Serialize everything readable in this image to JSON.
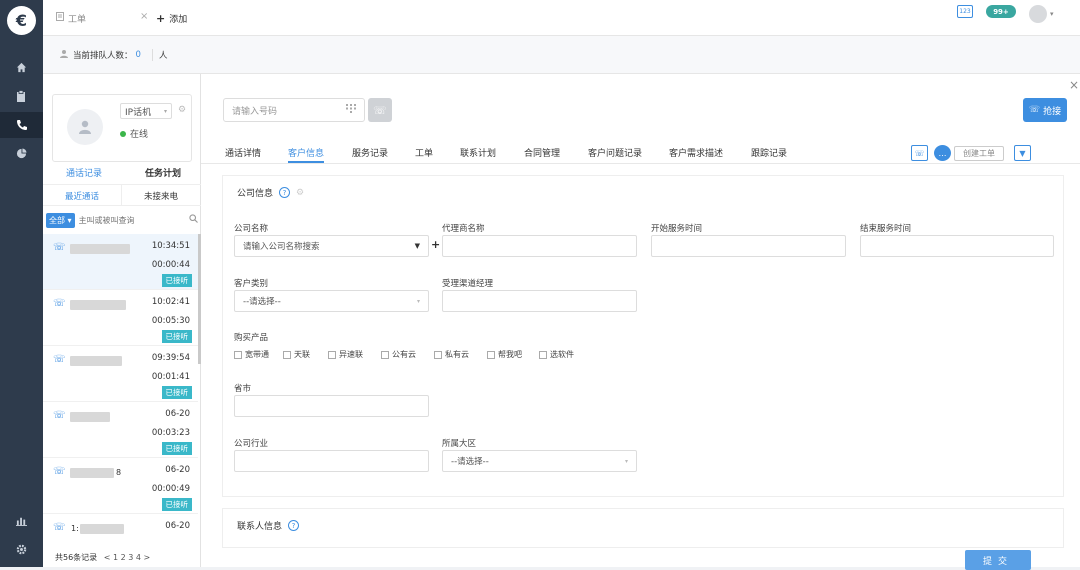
{
  "topbar": {
    "tab_label": "工单",
    "add_label": "添加",
    "badge_count": "99+",
    "keypad_label": "123"
  },
  "queue": {
    "label": "当前排队人数：",
    "count": "0",
    "unit": "人"
  },
  "agent": {
    "phone_type": "IP话机",
    "status": "在线"
  },
  "left_tabs": {
    "records": "通话记录",
    "tasks": "任务计划",
    "recent": "最近通话",
    "missed": "未接来电"
  },
  "search": {
    "all_label": "全部",
    "placeholder": "主叫或被叫查询"
  },
  "calls": [
    {
      "time": "10:34:51",
      "duration": "00:00:44",
      "status": "已接听",
      "suffix": ""
    },
    {
      "time": "10:02:41",
      "duration": "00:05:30",
      "status": "已接听",
      "suffix": ""
    },
    {
      "time": "09:39:54",
      "duration": "00:01:41",
      "status": "已接听",
      "suffix": ""
    },
    {
      "time": "06-20",
      "duration": "00:03:23",
      "status": "已接听",
      "suffix": ""
    },
    {
      "time": "06-20",
      "duration": "00:00:49",
      "status": "已接听",
      "suffix": "8"
    },
    {
      "time": "06-20",
      "duration": "",
      "status": "",
      "suffix": "1:"
    }
  ],
  "pager": {
    "total": "共56条记录",
    "pages": "< 1 2 3 4 >"
  },
  "main": {
    "phone_placeholder": "请输入号码",
    "grab_label": "抢接",
    "tabs": [
      "通话详情",
      "客户信息",
      "服务记录",
      "工单",
      "联系计划",
      "合同管理",
      "客户问题记录",
      "客户需求描述",
      "跟踪记录"
    ],
    "create_ticket": "创建工单"
  },
  "company": {
    "title": "公司信息",
    "company_name_label": "公司名称",
    "company_name_placeholder": "请输入公司名称搜索",
    "agent_name_label": "代理商名称",
    "start_label": "开始服务时间",
    "end_label": "结束服务时间",
    "customer_type_label": "客户类别",
    "select_placeholder": "--请选择--",
    "manager_label": "受理渠道经理",
    "products_label": "购买产品",
    "products": [
      "宽带通",
      "天联",
      "异速联",
      "公有云",
      "私有云",
      "帮我吧",
      "选软件"
    ],
    "province_label": "省市",
    "industry_label": "公司行业",
    "region_label": "所属大区",
    "region_placeholder": "--请选择--"
  },
  "contact": {
    "title": "联系人信息"
  },
  "submit_label": "提交"
}
